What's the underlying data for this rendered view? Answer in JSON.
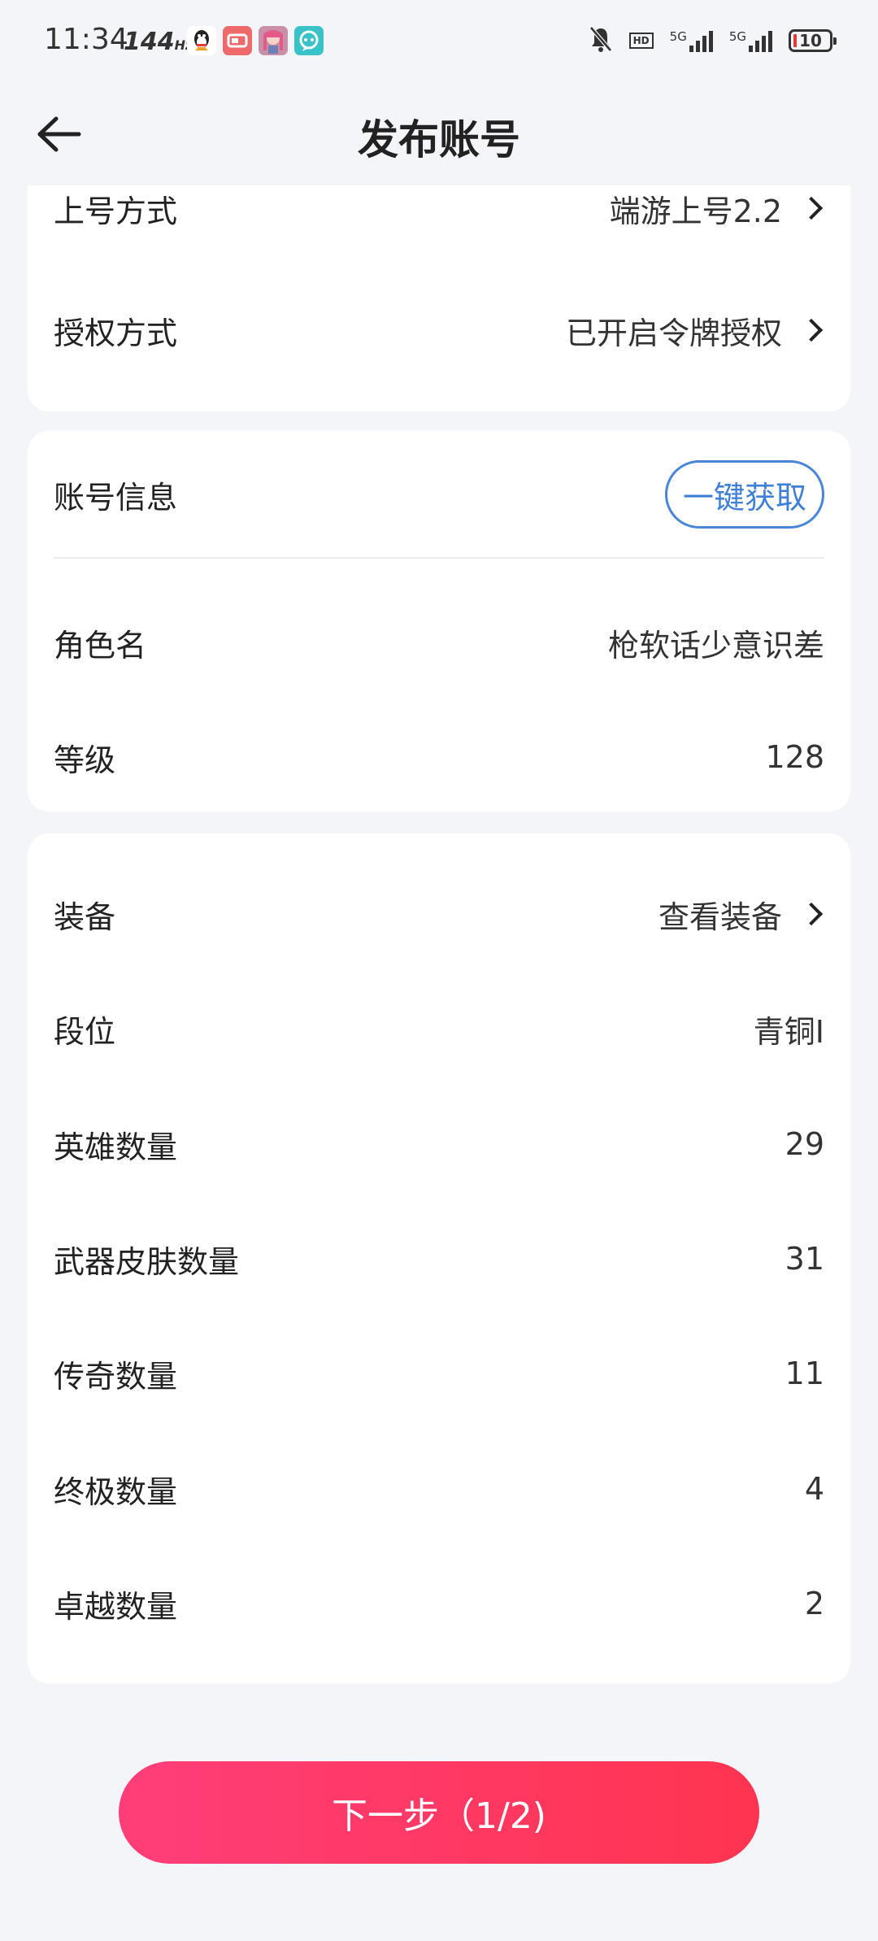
{
  "status_bar": {
    "time": "11:34",
    "refresh_rate": "144",
    "refresh_unit": "Hz",
    "network_1": "5G",
    "network_2": "5G",
    "hd_label": "HD",
    "battery": "10"
  },
  "header": {
    "title": "发布账号"
  },
  "login_section": {
    "rows": [
      {
        "label": "上号方式",
        "value": "端游上号2.2"
      },
      {
        "label": "授权方式",
        "value": "已开启令牌授权"
      }
    ]
  },
  "account_info": {
    "title": "账号信息",
    "fetch_button": "一键获取",
    "rows": [
      {
        "label": "角色名",
        "value": "枪软话少意识差"
      },
      {
        "label": "等级",
        "value": "128"
      }
    ]
  },
  "details": {
    "equipment": {
      "label": "装备",
      "value": "查看装备"
    },
    "rows": [
      {
        "label": "段位",
        "value": "青铜I"
      },
      {
        "label": "英雄数量",
        "value": "29"
      },
      {
        "label": "武器皮肤数量",
        "value": "31"
      },
      {
        "label": "传奇数量",
        "value": "11"
      },
      {
        "label": "终极数量",
        "value": "4"
      },
      {
        "label": "卓越数量",
        "value": "2"
      }
    ]
  },
  "next_button": {
    "label": "下一步（1/2)"
  },
  "colors": {
    "accent_blue": "#3f7fd6",
    "button_start": "#ff3e79",
    "button_end": "#ff3450",
    "background": "#f3f5f9"
  }
}
